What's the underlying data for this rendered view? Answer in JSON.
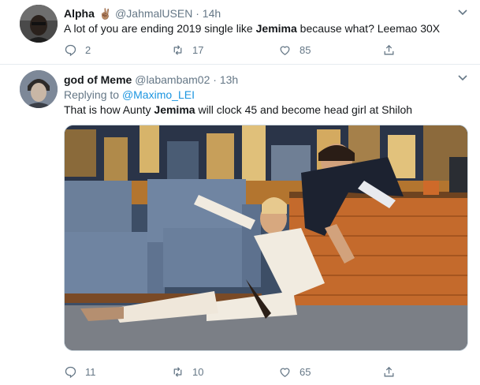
{
  "tweets": [
    {
      "name": "Alpha",
      "emoji": "✌🏽",
      "handle": "@JahmalUSEN",
      "dot": "·",
      "time": "14h",
      "text_pre": "A lot of you are ending 2019 single like ",
      "text_bold": "Jemima",
      "text_post": " because what? Leemao 30X",
      "replies": "2",
      "retweets": "17",
      "likes": "85"
    },
    {
      "name": "god of Meme",
      "handle": "@labambam02",
      "dot": "·",
      "time": "13h",
      "replying_prefix": "Replying to ",
      "replying_to": "@Maximo_LEI",
      "text_pre": "That is how Aunty ",
      "text_bold": "Jemima",
      "text_post": " will clock 45 and become head girl at Shiloh",
      "replies": "11",
      "retweets": "10",
      "likes": "65"
    }
  ],
  "icons": {
    "reply": "reply-icon",
    "retweet": "retweet-icon",
    "like": "heart-icon",
    "share": "share-icon",
    "caret": "chevron-down-icon"
  },
  "colors": {
    "text": "#14171a",
    "secondary": "#657786",
    "link": "#1b95e0",
    "border": "#e6ecf0"
  }
}
